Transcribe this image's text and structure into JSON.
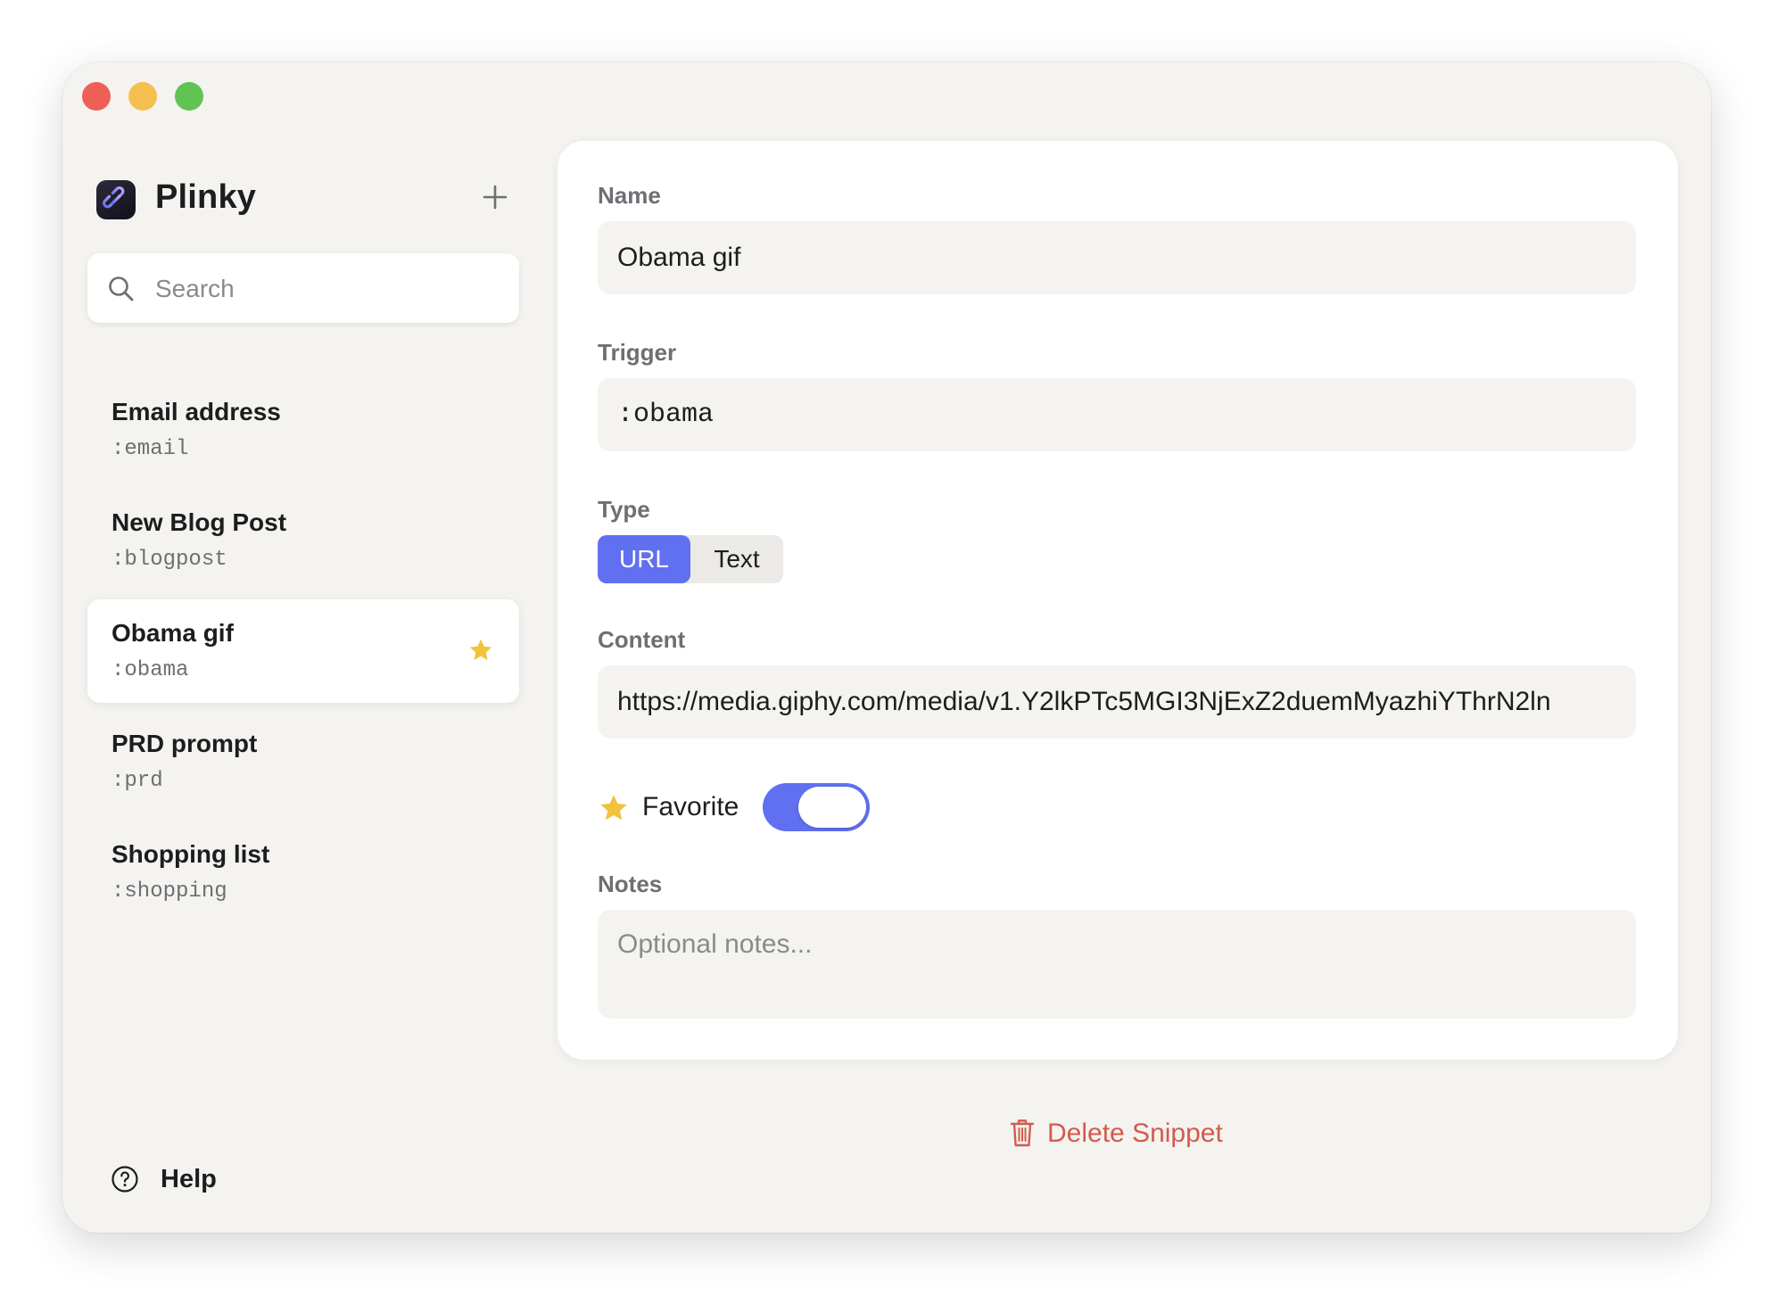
{
  "window": {
    "controls": [
      "close",
      "minimize",
      "zoom"
    ]
  },
  "sidebar": {
    "app_name": "Plinky",
    "add_icon": "plus-icon",
    "search": {
      "placeholder": "Search",
      "value": ""
    },
    "items": [
      {
        "title": "Email address",
        "trigger": ":email",
        "favorite": false,
        "selected": false
      },
      {
        "title": "New Blog Post",
        "trigger": ":blogpost",
        "favorite": false,
        "selected": false
      },
      {
        "title": "Obama gif",
        "trigger": ":obama",
        "favorite": true,
        "selected": true
      },
      {
        "title": "PRD prompt",
        "trigger": ":prd",
        "favorite": false,
        "selected": false
      },
      {
        "title": "Shopping list",
        "trigger": ":shopping",
        "favorite": false,
        "selected": false
      }
    ],
    "help_label": "Help"
  },
  "detail": {
    "name_label": "Name",
    "name_value": "Obama gif",
    "trigger_label": "Trigger",
    "trigger_value": ":obama",
    "type_label": "Type",
    "type_options": [
      "URL",
      "Text"
    ],
    "type_selected": "URL",
    "content_label": "Content",
    "content_value": "https://media.giphy.com/media/v1.Y2lkPTc5MGI3NjExZ2duemMyazhiYThrN2ln",
    "favorite_label": "Favorite",
    "favorite_on": true,
    "notes_label": "Notes",
    "notes_placeholder": "Optional notes...",
    "notes_value": "",
    "delete_label": "Delete Snippet"
  },
  "colors": {
    "accent": "#6070f0",
    "star": "#f2c23c",
    "danger": "#d45a4d",
    "window_bg": "#f4f3f0"
  }
}
